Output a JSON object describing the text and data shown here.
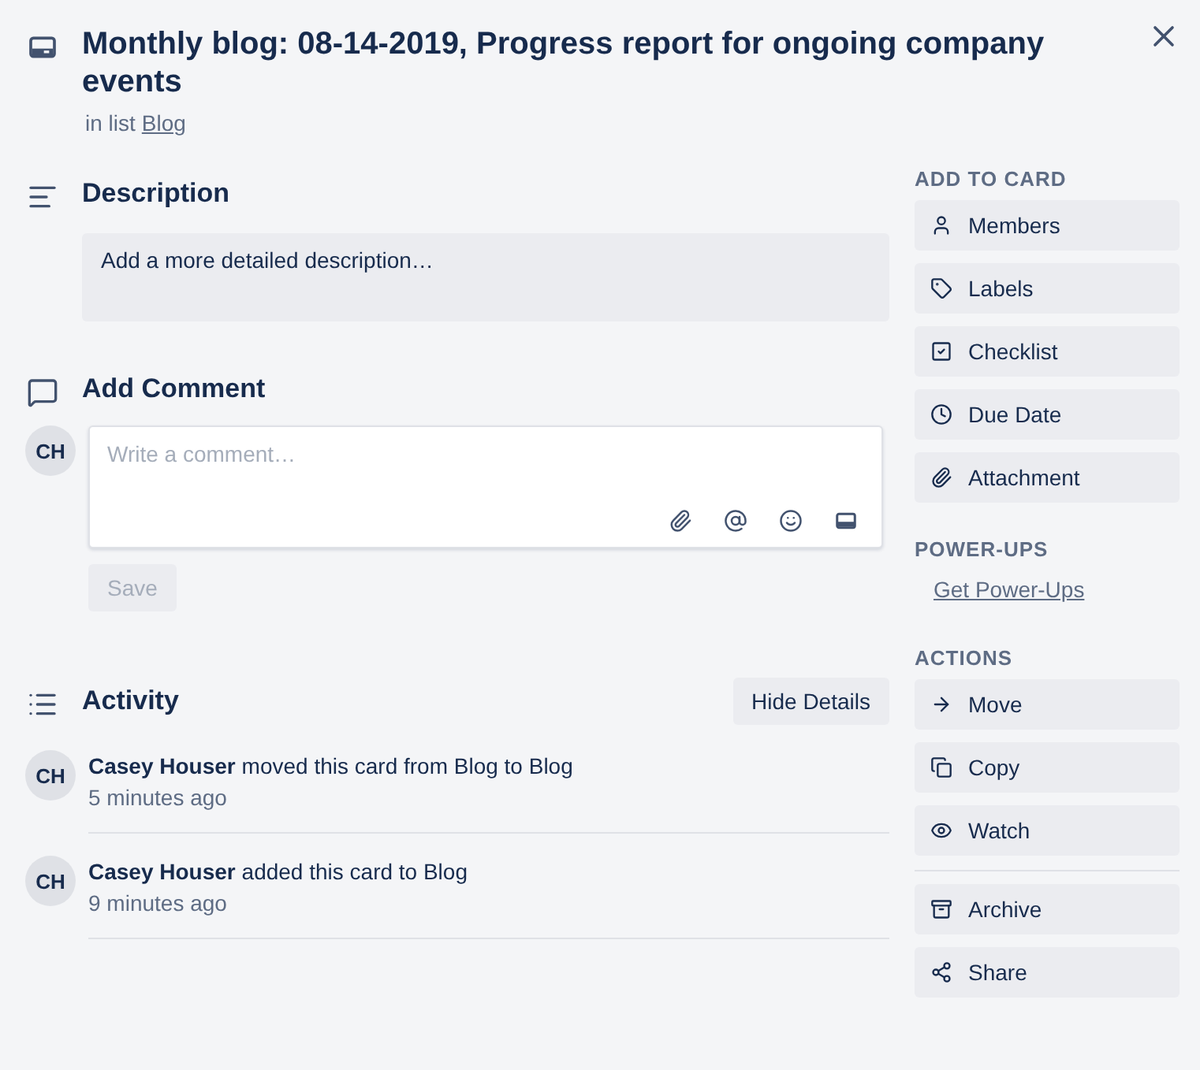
{
  "card": {
    "title": "Monthly blog: 08-14-2019, Progress report for ongoing company events",
    "list_prefix": "in list",
    "list_name": "Blog"
  },
  "description": {
    "heading": "Description",
    "placeholder": "Add a more detailed description…"
  },
  "comment": {
    "heading": "Add Comment",
    "avatar": "CH",
    "placeholder": "Write a comment…",
    "tools": [
      {
        "kind": "attach"
      },
      {
        "kind": "mention"
      },
      {
        "kind": "emoji"
      },
      {
        "kind": "card"
      }
    ],
    "save": {
      "label": "Save",
      "disabled": true
    }
  },
  "activity": {
    "heading": "Activity",
    "toggle": "Hide Details",
    "entries": [
      {
        "avatar": "CH",
        "text": "**Casey Houser** moved this card from Blog to Blog",
        "time": "5 minutes ago"
      },
      {
        "avatar": "CH",
        "text": "**Casey Houser** added this card to Blog",
        "time": "9 minutes ago"
      }
    ]
  },
  "sidebar": [
    {
      "heading": "ADD TO CARD",
      "kind": "buttons",
      "groups": [
        [
          {
            "label": "Members"
          },
          {
            "label": "Labels"
          },
          {
            "label": "Checklist"
          },
          {
            "label": "Due Date"
          },
          {
            "label": "Attachment"
          }
        ]
      ]
    },
    {
      "heading": "POWER-UPS",
      "kind": "link",
      "link": "Get Power-Ups"
    },
    {
      "heading": "ACTIONS",
      "kind": "buttons",
      "groups": [
        [
          {
            "label": "Move"
          },
          {
            "label": "Copy"
          },
          {
            "label": "Watch"
          }
        ],
        [
          {
            "label": "Archive"
          },
          {
            "label": "Share"
          }
        ]
      ]
    }
  ]
}
